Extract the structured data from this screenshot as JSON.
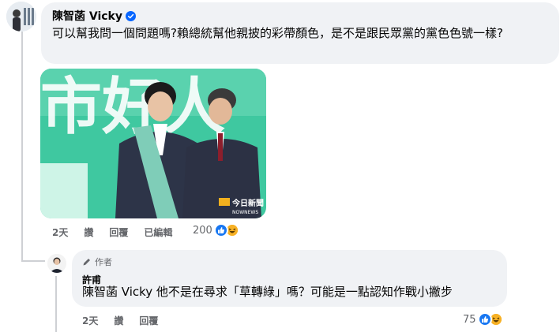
{
  "main_comment": {
    "author": "陳智菡 Vicky",
    "text": "可以幫我問一個問題嗎?賴總統幫他親披的彩帶顏色，是不是跟民眾黨的黨色色號一樣?",
    "photo": {
      "background_text": "市好人",
      "watermark": "今日新聞",
      "watermark_sub": "NOWNEWS"
    },
    "actions": {
      "time": "2天",
      "like": "讚",
      "reply": "回覆",
      "edited": "已編輯"
    },
    "reactions": {
      "count": "200",
      "types": [
        "like",
        "haha"
      ]
    }
  },
  "reply_comment": {
    "badge_icon": "pencil-icon",
    "badge": "作者",
    "author": "許甫",
    "text": "陳智菡 Vicky 他不是在尋求「草轉綠」嗎？可能是一點認知作戰小撇步",
    "actions": {
      "time": "2天",
      "like": "讚",
      "reply": "回覆"
    },
    "reactions": {
      "count": "75",
      "types": [
        "like",
        "haha"
      ]
    }
  },
  "colors": {
    "bubble": "#f0f2f5",
    "meta_text": "#65676b",
    "like_blue": "#1877f2",
    "verified_blue": "#0866ff",
    "photo_green": "#3fc8a0",
    "sash_teal": "#7fcdb8"
  }
}
